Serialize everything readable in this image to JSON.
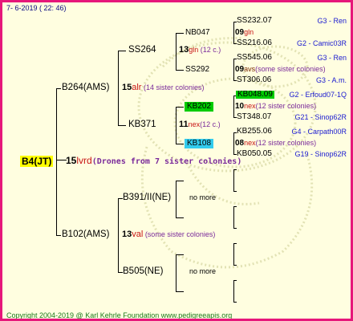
{
  "header": {
    "date": "7-  6-2019 ( 22: 46)"
  },
  "colors": {
    "border": "#e6177a",
    "background": "#fffee0",
    "highlight_root": "#ffff00",
    "highlight_green": "#00cc00",
    "highlight_cyan": "#33ccee"
  },
  "root": {
    "name": "B4(JT)",
    "year": "15",
    "code": "lvrd",
    "note": "(Drones from 7 sister colonies)"
  },
  "l1": [
    {
      "name": "B264(AMS)",
      "year": "15",
      "code": "alr",
      "note": " (14 sister colonies)"
    },
    {
      "name": "B102(AMS)",
      "year": "13",
      "code": "val",
      "note": " (some sister colonies)"
    }
  ],
  "l2": [
    {
      "name": "SS264",
      "year": "13",
      "code": "gln",
      "note": " (12 c.)"
    },
    {
      "name": "KB371",
      "year": "11",
      "code": "nex",
      "note": "(12 c.)"
    },
    {
      "name": "B391/II(NE)",
      "note": "no more"
    },
    {
      "name": "B505(NE)",
      "note": "no more"
    }
  ],
  "l3": [
    {
      "name": "NB047",
      "year": "09",
      "code": "gln"
    },
    {
      "name": "SS292",
      "year": "09",
      "code": "avs",
      "note": "(some sister colonies)"
    },
    {
      "name": "KB202",
      "year": "10",
      "code": "nex",
      "note": "(12 sister colonies)"
    },
    {
      "name": "KB108",
      "year": "08",
      "code": "nex",
      "note": "(12 sister colonies)"
    }
  ],
  "l4": [
    {
      "name": "SS232.07",
      "breeder": "G3 - Ren"
    },
    {
      "name": "SS216.06",
      "breeder": "G2 - Camic03R"
    },
    {
      "name": "SS545.06",
      "breeder": "G3 - Ren"
    },
    {
      "name": "ST306.06",
      "breeder": "G3 - A.m."
    },
    {
      "name": "KB048.09",
      "breeder": "G2 - Erfoud07-1Q"
    },
    {
      "name": "ST348.07",
      "breeder": "G21 - Sinop62R"
    },
    {
      "name": "KB255.06",
      "breeder": "G4 - Carpath00R"
    },
    {
      "name": "KB050.05",
      "breeder": "G19 - Sinop62R"
    }
  ],
  "footer": {
    "text": "Copyright 2004-2019 @ Karl Kehrle Foundation    www.pedigreeapis.org"
  }
}
